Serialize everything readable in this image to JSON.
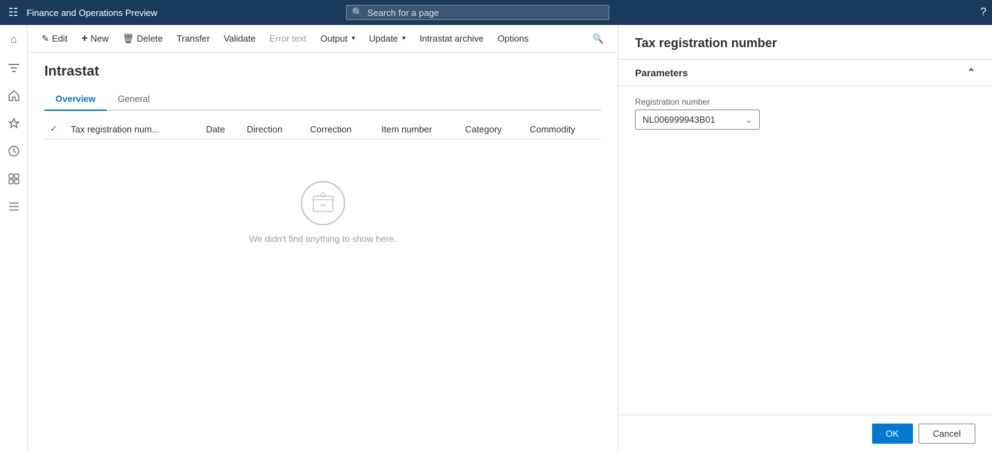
{
  "topNav": {
    "appTitle": "Finance and Operations Preview",
    "searchPlaceholder": "Search for a page",
    "helpIcon": "?"
  },
  "toolbar": {
    "editLabel": "Edit",
    "newLabel": "New",
    "deleteLabel": "Delete",
    "transferLabel": "Transfer",
    "validateLabel": "Validate",
    "errorTextLabel": "Error text",
    "outputLabel": "Output",
    "updateLabel": "Update",
    "intrastatArchiveLabel": "Intrastat archive",
    "optionsLabel": "Options",
    "searchIcon": "🔍"
  },
  "page": {
    "title": "Intrastat",
    "tabs": [
      {
        "label": "Overview",
        "active": true
      },
      {
        "label": "General",
        "active": false
      }
    ]
  },
  "table": {
    "columns": [
      {
        "key": "check",
        "label": ""
      },
      {
        "key": "taxReg",
        "label": "Tax registration num..."
      },
      {
        "key": "date",
        "label": "Date"
      },
      {
        "key": "direction",
        "label": "Direction"
      },
      {
        "key": "correction",
        "label": "Correction"
      },
      {
        "key": "itemNumber",
        "label": "Item number"
      },
      {
        "key": "category",
        "label": "Category"
      },
      {
        "key": "commodity",
        "label": "Commodity"
      }
    ],
    "rows": [],
    "emptyMessage": "We didn't find anything to show here."
  },
  "rightPanel": {
    "title": "Tax registration number",
    "parametersLabel": "Parameters",
    "fields": {
      "registrationNumberLabel": "Registration number",
      "registrationNumberValue": "NL006999943B01"
    },
    "footer": {
      "okLabel": "OK",
      "cancelLabel": "Cancel"
    }
  },
  "sidebar": {
    "items": [
      {
        "icon": "⊞",
        "name": "home"
      },
      {
        "icon": "☆",
        "name": "favorites"
      },
      {
        "icon": "🕐",
        "name": "recent"
      },
      {
        "icon": "⊟",
        "name": "workspaces"
      },
      {
        "icon": "☰",
        "name": "modules"
      }
    ],
    "filterIcon": "⛉"
  }
}
